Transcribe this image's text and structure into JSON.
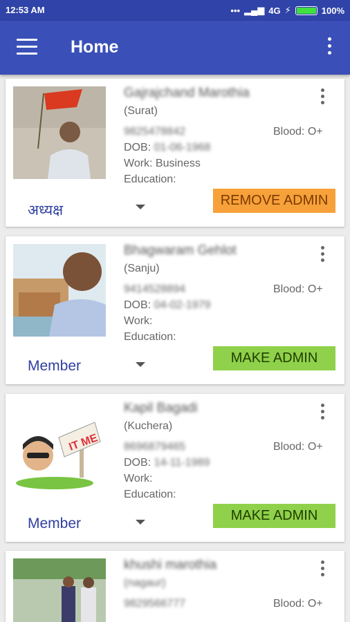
{
  "status_bar": {
    "time": "12:53 AM",
    "network": "4G",
    "battery": "100%",
    "battery_level": 1.0
  },
  "app_bar": {
    "title": "Home"
  },
  "members": [
    {
      "name": "Gajrajchand Marothia",
      "city": "(Surat)",
      "phone": "9825478842",
      "dob": "DOB: 01-06-1968",
      "blood": "Blood: O+",
      "work": "Work: Business",
      "education": "Education:",
      "role": "अध्यक्ष",
      "action": "REMOVE ADMIN",
      "action_type": "remove"
    },
    {
      "name": "Bhagwaram Gehlot",
      "city": "(Sanju)",
      "phone": "9414528894",
      "dob": "DOB: 04-02-1979",
      "blood": "Blood: O+",
      "work": "Work:",
      "education": "Education:",
      "role": "Member",
      "action": "MAKE ADMIN",
      "action_type": "make"
    },
    {
      "name": "Kapil Bagadi",
      "city": "(Kuchera)",
      "phone": "8696879465",
      "dob": "DOB: 14-11-1989",
      "blood": "Blood: O+",
      "work": "Work:",
      "education": "Education:",
      "role": "Member",
      "action": "MAKE ADMIN",
      "action_type": "make"
    },
    {
      "name": "khushi marothia",
      "city": "(nagaur)",
      "phone": "9829566777",
      "blood": "Blood: O+"
    }
  ]
}
